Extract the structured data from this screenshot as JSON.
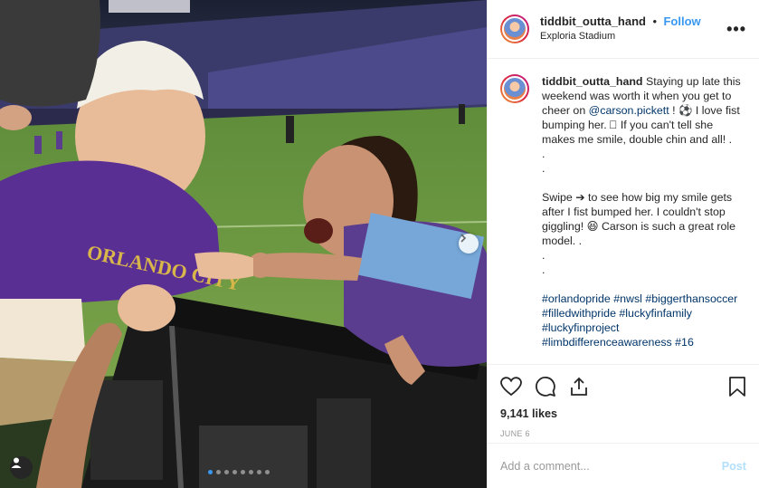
{
  "post": {
    "username": "tiddbit_outta_hand",
    "separator": "•",
    "follow_label": "Follow",
    "location": "Exploria Stadium",
    "more_label": "•••"
  },
  "caption": {
    "username": "tiddbit_outta_hand",
    "line1": "Staying up late this weekend was worth it when you get to cheer on ",
    "mention": "@carson.pickett",
    "line1b": " ! ⚽ I love fist bumping her. ⃞ If you can't tell she makes me smile, double chin and all! .",
    "dot1": ".",
    "dot2": ".",
    "para2": "Swipe ➔ to see how big my smile gets after I fist bumped her. I couldn't stop giggling! 😆 Carson is such a great role model. .",
    "dot3": ".",
    "dot4": ".",
    "hashtags": "#orlandopride #nwsl #biggerthansoccer #filledwithpride #luckyfinfamily #luckyfinproject #limbdifferenceawareness #16"
  },
  "stats": {
    "likes": "9,141 likes",
    "date": "JUNE 6"
  },
  "comment": {
    "placeholder": "Add a comment...",
    "post_label": "Post"
  },
  "carousel": {
    "slide_count": 8,
    "active_index": 0
  },
  "colors": {
    "link": "#3897f0",
    "hashtag": "#003569",
    "post_disabled": "#b2dffc",
    "muted": "#999999"
  },
  "icons": [
    "heart-icon",
    "comment-icon",
    "share-icon",
    "bookmark-icon",
    "user-tag-icon",
    "chevron-right-icon",
    "more-icon"
  ]
}
